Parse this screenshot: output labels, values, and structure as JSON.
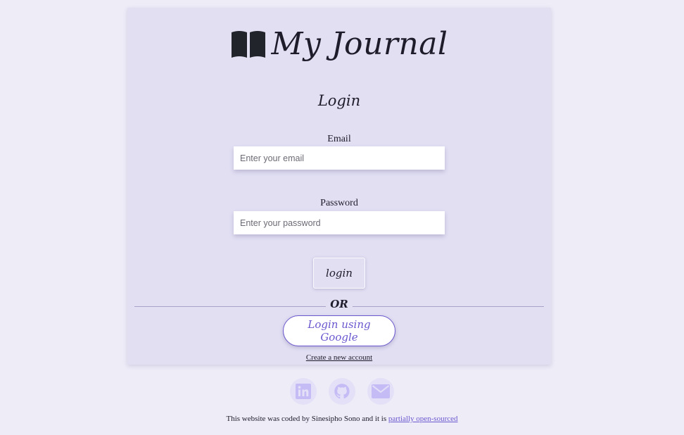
{
  "brand": {
    "title": "My Journal",
    "icon": "open-book-icon"
  },
  "heading": "Login",
  "form": {
    "email_label": "Email",
    "email_placeholder": "Enter your email",
    "email_value": "",
    "password_label": "Password",
    "password_placeholder": "Enter your password",
    "password_value": "",
    "login_label": "login"
  },
  "divider_text": "OR",
  "google_label": "Login using Google",
  "create_account_label": "Create a new account",
  "socials": [
    {
      "name": "linkedin",
      "icon": "linkedin-icon"
    },
    {
      "name": "github",
      "icon": "github-icon"
    },
    {
      "name": "email",
      "icon": "envelope-icon"
    }
  ],
  "footer": {
    "text": "This website was coded by Sinesipho Sono and it is ",
    "link_text": "partially open-sourced"
  },
  "colors": {
    "page_bg": "#eeecf7",
    "card_bg": "#e2dff3",
    "accent": "#6a58cf",
    "social_icon": "#c5bcf6",
    "text": "#1e1c2a"
  }
}
